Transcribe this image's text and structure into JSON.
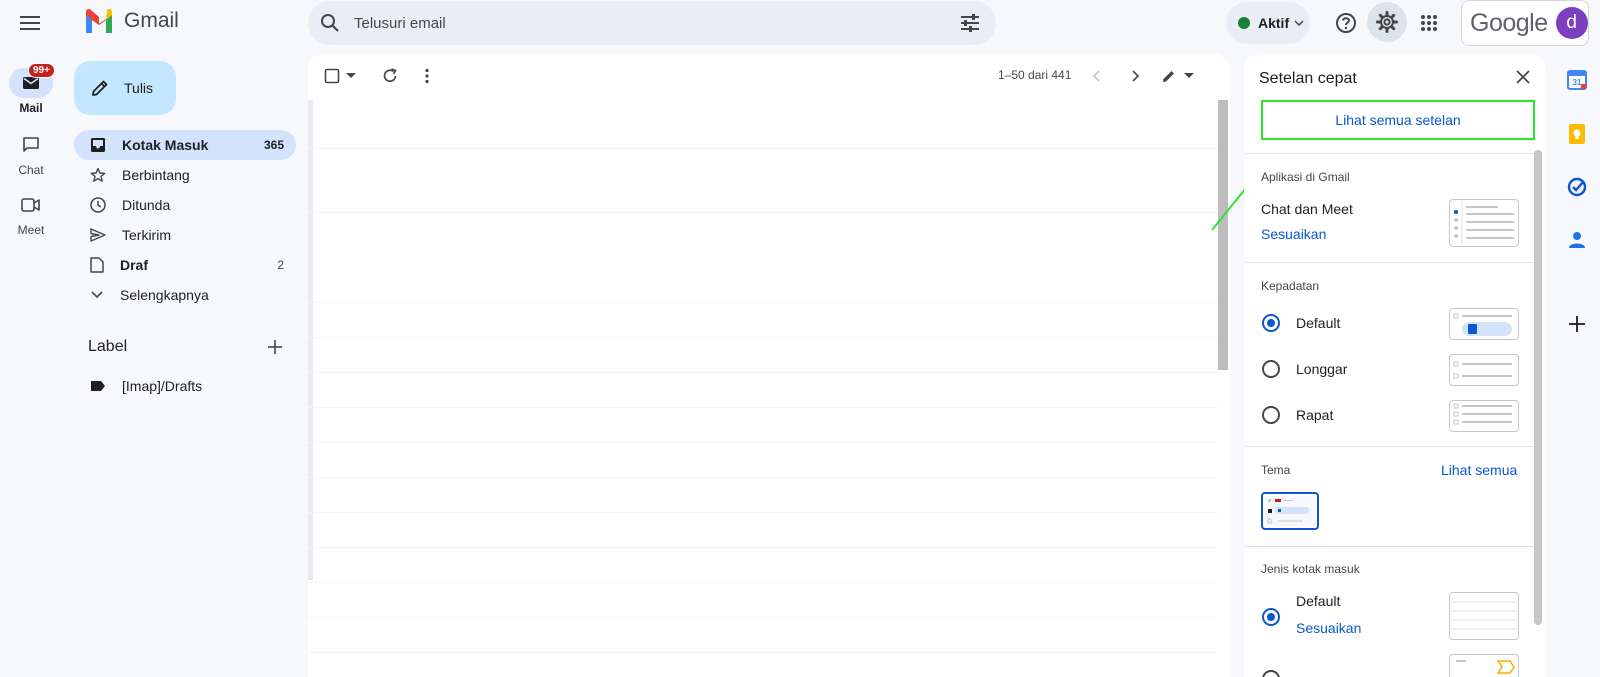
{
  "header": {
    "app_name": "Gmail",
    "search_placeholder": "Telusuri email",
    "status_label": "Aktif",
    "google_word": "Google",
    "avatar_letter": "d"
  },
  "rail": {
    "mail_label": "Mail",
    "mail_badge": "99+",
    "chat_label": "Chat",
    "meet_label": "Meet"
  },
  "nav": {
    "compose_label": "Tulis",
    "items": [
      {
        "label": "Kotak Masuk",
        "count": "365"
      },
      {
        "label": "Berbintang",
        "count": ""
      },
      {
        "label": "Ditunda",
        "count": ""
      },
      {
        "label": "Terkirim",
        "count": ""
      },
      {
        "label": "Draf",
        "count": "2"
      },
      {
        "label": "Selengkapnya",
        "count": ""
      }
    ],
    "labels_heading": "Label",
    "labels": [
      "[Imap]/Drafts"
    ]
  },
  "toolbar": {
    "pagination": "1–50 dari 441"
  },
  "quick_settings": {
    "title": "Setelan cepat",
    "see_all_settings": "Lihat semua setelan",
    "apps_section": "Aplikasi di Gmail",
    "chat_meet_label": "Chat dan Meet",
    "customize_link": "Sesuaikan",
    "density_section": "Kepadatan",
    "density_options": [
      {
        "label": "Default",
        "selected": true
      },
      {
        "label": "Longgar",
        "selected": false
      },
      {
        "label": "Rapat",
        "selected": false
      }
    ],
    "theme_section": "Tema",
    "theme_see_all": "Lihat semua",
    "inbox_type_section": "Jenis kotak masuk",
    "inbox_default_label": "Default",
    "inbox_customize_link": "Sesuaikan"
  },
  "colors": {
    "accent": "#0b57d0",
    "highlight_border": "#2ee52e",
    "badge": "#c5221f",
    "status_green": "#188038",
    "avatar": "#7b3fbf"
  }
}
